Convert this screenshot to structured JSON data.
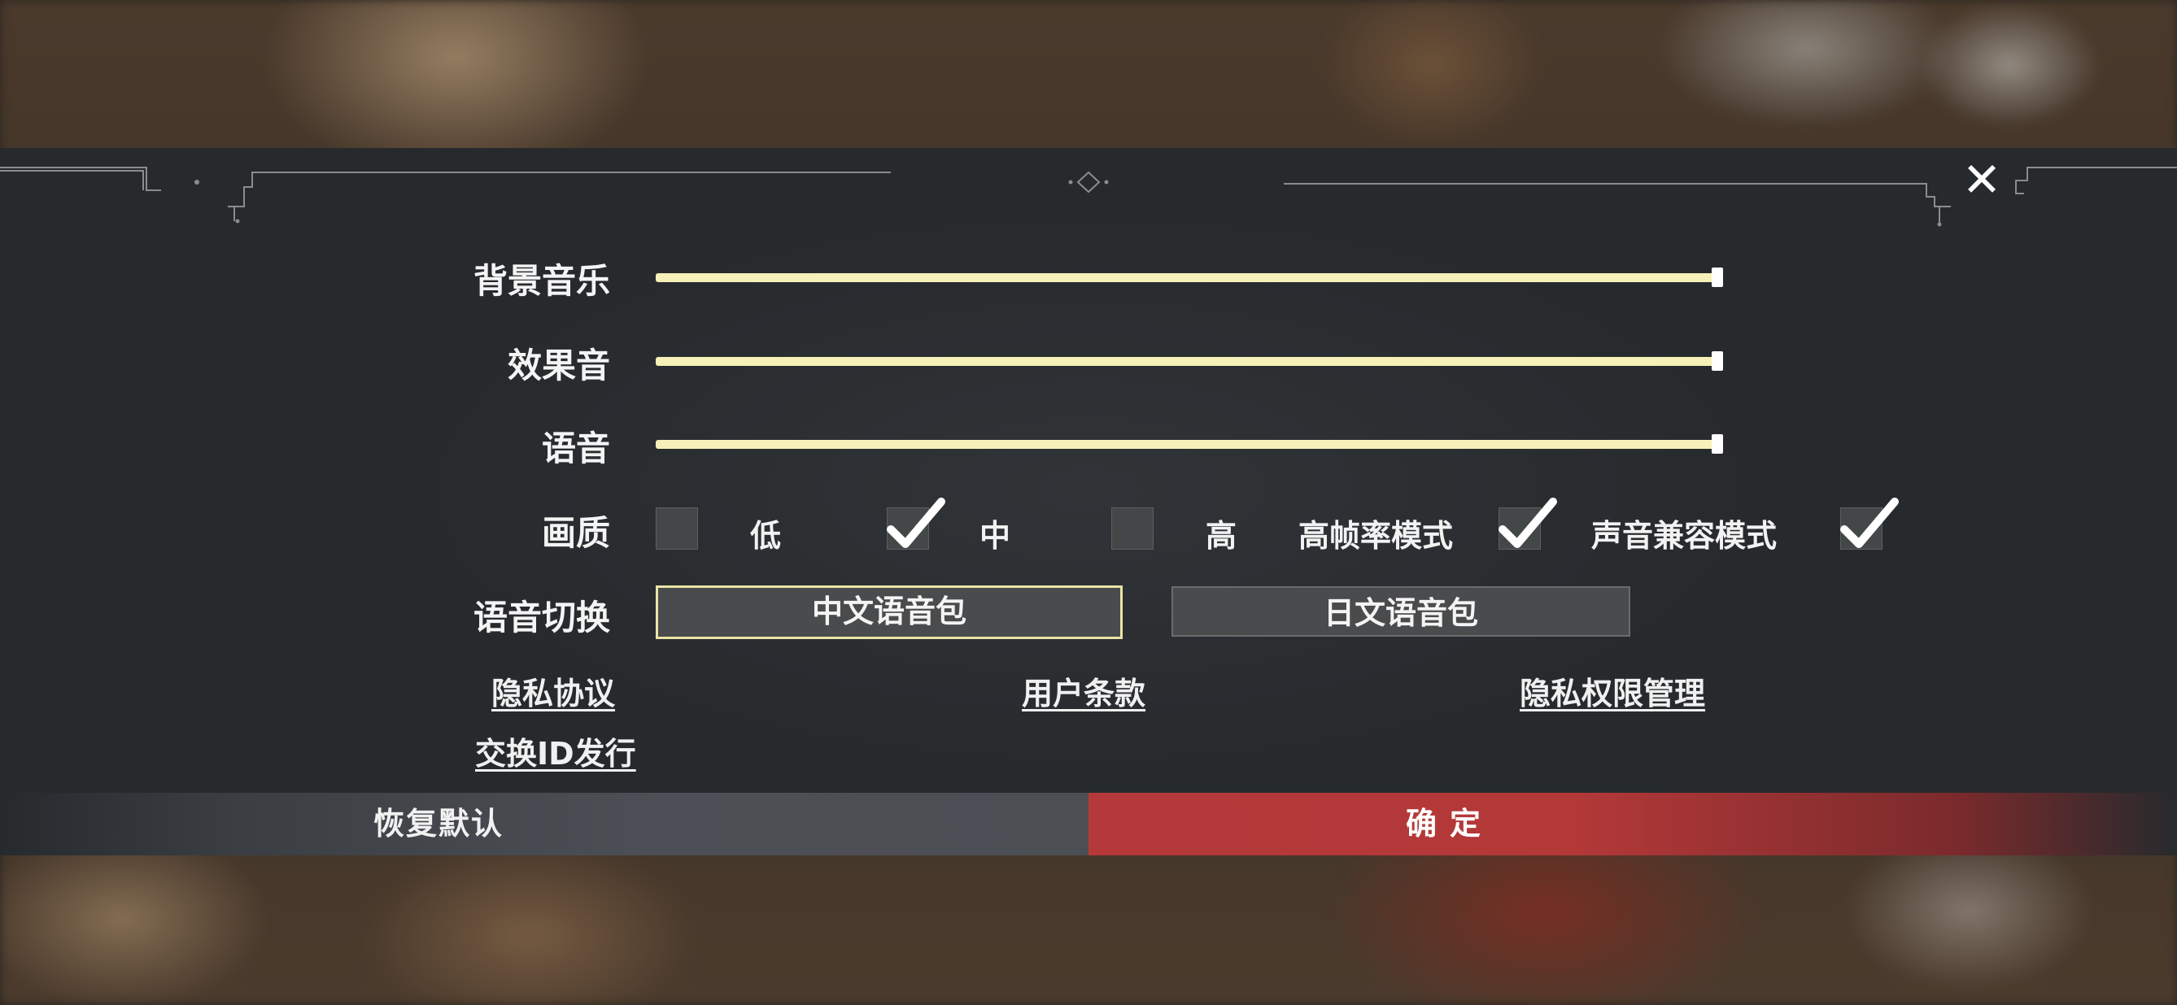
{
  "dialog": {
    "close_icon": "close-icon",
    "sliders": [
      {
        "label": "背景音乐",
        "value": 1.0
      },
      {
        "label": "效果音",
        "value": 1.0
      },
      {
        "label": "语音",
        "value": 1.0
      }
    ],
    "quality": {
      "label": "画质",
      "options": [
        {
          "label": "低",
          "checked": false
        },
        {
          "label": "中",
          "checked": true
        },
        {
          "label": "高",
          "checked": false
        }
      ],
      "high_fps": {
        "label": "高帧率模式",
        "checked": true
      },
      "audio_compat": {
        "label": "声音兼容模式",
        "checked": true
      }
    },
    "voice_switch": {
      "label": "语音切换",
      "options": [
        {
          "label": "中文语音包",
          "selected": true
        },
        {
          "label": "日文语音包",
          "selected": false
        }
      ]
    },
    "links": {
      "privacy_agreement": "隐私协议",
      "user_terms": "用户条款",
      "privacy_permissions": "隐私权限管理",
      "exchange_id": "交换ID发行"
    },
    "footer": {
      "reset_label": "恢复默认",
      "confirm_label": "确定"
    },
    "colors": {
      "slider_fill": "#f6f1b8",
      "selected_border": "#e9e4a6",
      "confirm_red": "#b5393a",
      "panel_bg": "#272a2d"
    }
  }
}
